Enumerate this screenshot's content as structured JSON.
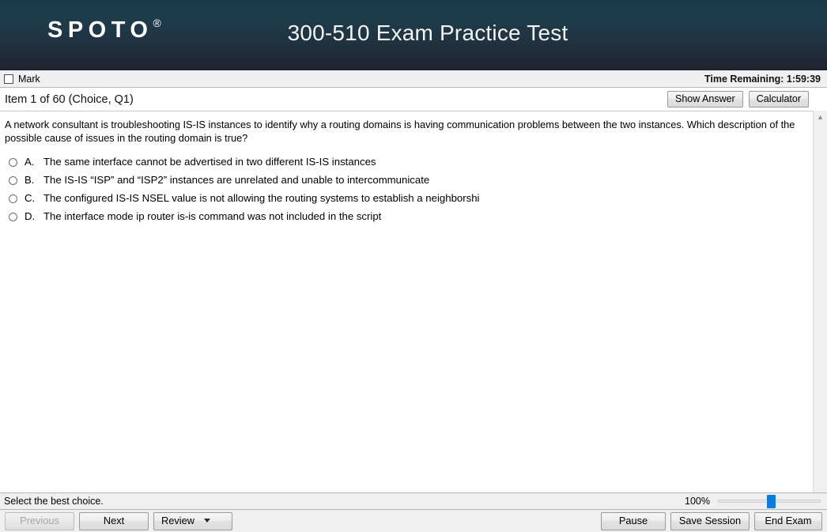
{
  "header": {
    "brand": "SPOTO",
    "brand_mark": "®",
    "title": "300-510 Exam Practice Test"
  },
  "markbar": {
    "mark_label": "Mark",
    "timer": "Time Remaining: 1:59:39"
  },
  "itembar": {
    "item_label": "Item 1 of 60 (Choice, Q1)",
    "show_answer_label": "Show Answer",
    "calculator_label": "Calculator"
  },
  "question": {
    "text": "A network consultant is troubleshooting IS-IS instances to identify why a routing domains is having communication problems between the two instances. Which description of the possible cause of issues in the routing domain is true?",
    "choices": [
      {
        "letter": "A.",
        "text": "The same interface cannot be advertised in two different IS-IS instances",
        "selected": false
      },
      {
        "letter": "B.",
        "text": "The IS-IS “ISP” and “ISP2” instances are unrelated and unable to intercommunicate",
        "selected": false
      },
      {
        "letter": "C.",
        "text": "The configured IS-IS NSEL value is not allowing the routing systems to establish a neighborshi",
        "selected": false
      },
      {
        "letter": "D.",
        "text": "The interface mode ip router is-is command was not included in the script",
        "selected": false
      }
    ]
  },
  "statusbar": {
    "hint": "Select the best choice.",
    "zoom_level": "100%"
  },
  "footer": {
    "previous_label": "Previous",
    "next_label": "Next",
    "review_label": "Review",
    "pause_label": "Pause",
    "save_session_label": "Save Session",
    "end_exam_label": "End Exam"
  },
  "colors": {
    "header_top": "#1a3a49",
    "header_bottom": "#21222f",
    "slider_thumb": "#0a7ce0",
    "chrome": "#f0f0f0"
  }
}
